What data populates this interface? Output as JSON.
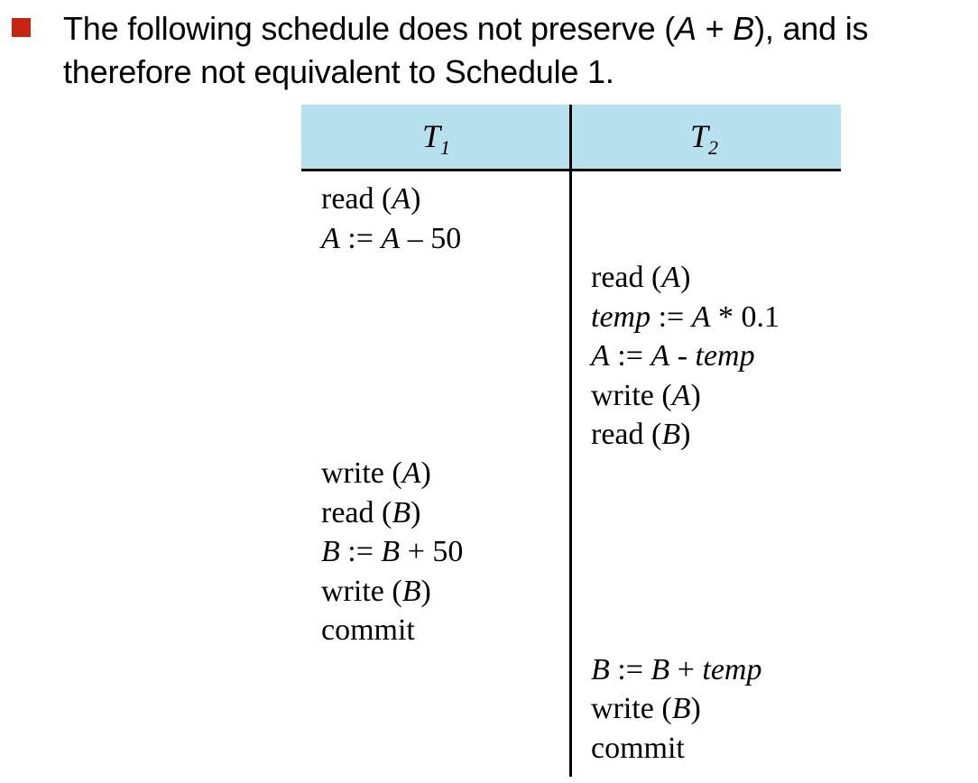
{
  "statement": {
    "line1_a": "The following schedule does not preserve (",
    "line1_A": "A",
    "line1_plus": " + ",
    "line1_B": "B",
    "line1_b": "), and is",
    "line2": "therefore not equivalent to Schedule 1."
  },
  "schedule": {
    "headers": [
      {
        "base": "T",
        "sub": "1"
      },
      {
        "base": "T",
        "sub": "2"
      }
    ],
    "t1_block1": [
      {
        "word": "read (",
        "var": "A",
        "end": ")"
      },
      {
        "var": "A",
        "op": " := ",
        "var2": "A",
        "tail": " – 50"
      }
    ],
    "t2_block1": [
      {
        "word": "read (",
        "var": "A",
        "end": ")"
      },
      {
        "var": "temp",
        "op": " := ",
        "var2": "A",
        "tail": " * 0.1"
      },
      {
        "var": "A",
        "op": " := ",
        "var2": "A",
        "mid": " - ",
        "var3": "temp"
      },
      {
        "word": "write (",
        "var": "A",
        "end": ")"
      },
      {
        "word": "read (",
        "var": "B",
        "end": ")"
      }
    ],
    "t1_block2": [
      {
        "word": "write (",
        "var": "A",
        "end": ")"
      },
      {
        "word": "read (",
        "var": "B",
        "end": ")"
      },
      {
        "var": "B",
        "op": " := ",
        "var2": "B",
        "tail": " + 50"
      },
      {
        "word": "write (",
        "var": "B",
        "end": ")"
      },
      {
        "word": "commit"
      }
    ],
    "t2_block2": [
      {
        "var": "B",
        "op": " := ",
        "var2": "B",
        "mid": " + ",
        "var3": "temp"
      },
      {
        "word": "write (",
        "var": "B",
        "end": ")"
      },
      {
        "word": "commit"
      }
    ]
  }
}
